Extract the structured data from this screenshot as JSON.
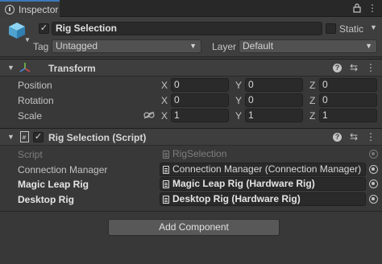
{
  "tab": {
    "title": "Inspector",
    "lock_icon": "lock-icon",
    "menu_icon": "more-vert-icon"
  },
  "gameobject": {
    "active": true,
    "name": "Rig Selection",
    "static_label": "Static",
    "static": false,
    "tag_label": "Tag",
    "tag_value": "Untagged",
    "layer_label": "Layer",
    "layer_value": "Default"
  },
  "transform": {
    "title": "Transform",
    "rows": [
      {
        "label": "Position",
        "x": "0",
        "y": "0",
        "z": "0"
      },
      {
        "label": "Rotation",
        "x": "0",
        "y": "0",
        "z": "0"
      },
      {
        "label": "Scale",
        "x": "1",
        "y": "1",
        "z": "1"
      }
    ],
    "axes": {
      "x": "X",
      "y": "Y",
      "z": "Z"
    }
  },
  "script_component": {
    "title": "Rig Selection (Script)",
    "enabled": true,
    "fields": [
      {
        "label": "Script",
        "value": "RigSelection",
        "disabled": true,
        "bold": false
      },
      {
        "label": "Connection Manager",
        "value": "Connection Manager (Connection Manager)",
        "disabled": false,
        "bold": false
      },
      {
        "label": "Magic Leap Rig",
        "value": "Magic Leap Rig (Hardware Rig)",
        "disabled": false,
        "bold": true
      },
      {
        "label": "Desktop Rig",
        "value": "Desktop Rig (Hardware Rig)",
        "disabled": false,
        "bold": true
      }
    ]
  },
  "add_component_label": "Add Component",
  "colors": {
    "background": "#383838",
    "tab_accent": "#3a79bb",
    "transform_icon_x": "#d94a4a",
    "transform_icon_y": "#74c14a",
    "transform_icon_z": "#4a8ad9"
  }
}
